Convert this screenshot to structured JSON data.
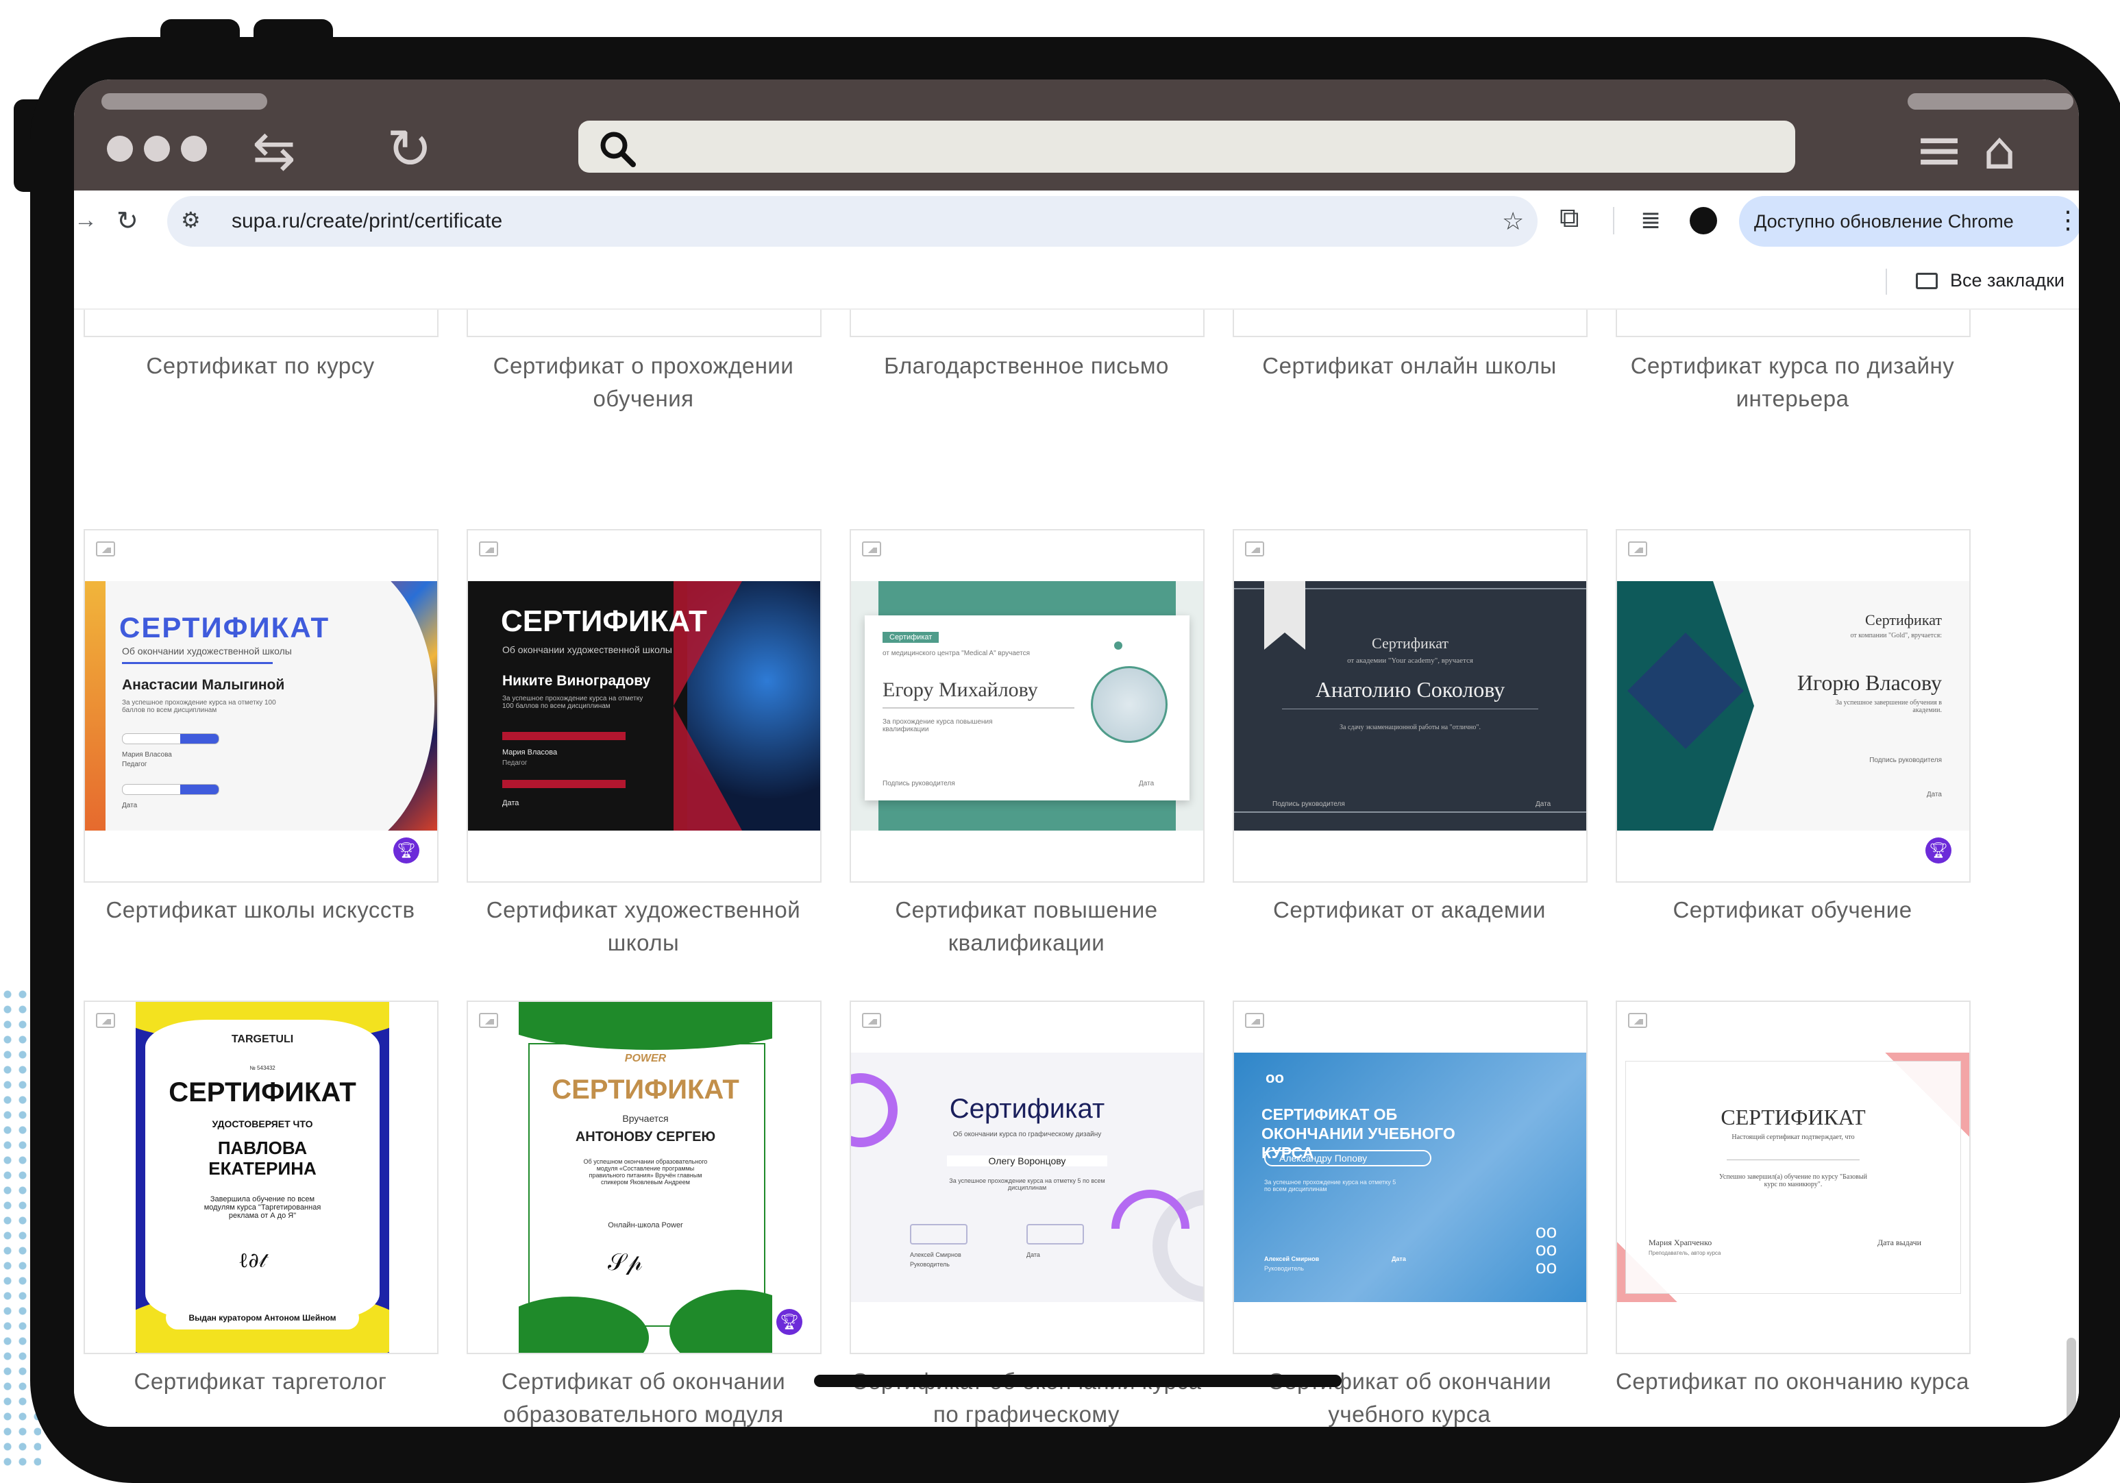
{
  "browser": {
    "url": "supa.ru/create/print/certificate",
    "update_label": "Доступно обновление Chrome",
    "bookmarks_label": "Все закладки"
  },
  "top_captions": [
    "Сертификат по курсу",
    "Сертификат о прохождении обучения",
    "Благодарственное письмо",
    "Сертификат онлайн школы",
    "Сертификат курса по дизайну интерьера"
  ],
  "rows": [
    {
      "cards": [
        {
          "caption": "Сертификат школы искусств",
          "premium": true,
          "thumb": {
            "title": "СЕРТИФИКАТ",
            "subtitle": "Об окончании художественной школы",
            "name": "Анастасии Малыгиной",
            "body": "За успешное прохождение курса на отметку 100 баллов по всем дисциплинам",
            "sign1": "Мария Власова",
            "sign1_role": "Педагог",
            "sign2": "Дата"
          }
        },
        {
          "caption": "Сертификат художественной школы",
          "premium": false,
          "thumb": {
            "title": "СЕРТИФИКАТ",
            "subtitle": "Об окончании художественной школы",
            "name": "Никите Виноградову",
            "body": "За успешное прохождение курса на отметку 100 баллов по всем дисциплинам",
            "sign1": "Мария Власова",
            "sign1_role": "Педагог",
            "sign2": "Дата"
          }
        },
        {
          "caption": "Сертификат повышение квалификации",
          "premium": false,
          "thumb": {
            "tag": "Сертификат",
            "subtitle": "от медицинского центра \"Medical A\" вручается",
            "name": "Егору Михайлову",
            "body": "За прохождение курса повышения квалификации",
            "sign1": "Подпись руководителя",
            "sign2": "Дата"
          }
        },
        {
          "caption": "Сертификат от академии",
          "premium": false,
          "thumb": {
            "title": "Сертификат",
            "subtitle": "от академии \"Your academy\", вручается",
            "name": "Анатолию Соколову",
            "body": "За сдачу экзаменационной работы на \"отлично\".",
            "sign1": "Подпись руководителя",
            "sign2": "Дата"
          }
        },
        {
          "caption": "Сертификат обучение",
          "premium": true,
          "thumb": {
            "title": "Сертификат",
            "subtitle": "от компании \"Gold\", вручается:",
            "name": "Игорю Власову",
            "body": "За успешное завершение обучения в академии.",
            "sign1": "Подпись руководителя",
            "sign2": "Дата"
          }
        }
      ]
    },
    {
      "cards": [
        {
          "caption": "Сертификат таргетолог",
          "premium": false,
          "thumb": {
            "brand": "TARGETULI",
            "number": "№ 543432",
            "title": "СЕРТИФИКАТ",
            "subtitle": "УДОСТОВЕРЯЕТ ЧТО",
            "name": "ПАВЛОВА ЕКАТЕРИНА",
            "body": "Завершила обучение по всем модулям курса \"Таргетированная реклама от А до Я\"",
            "footer": "Выдан куратором Антоном Шейном"
          }
        },
        {
          "caption": "Сертификат об окончании образовательного модуля",
          "premium": true,
          "thumb": {
            "brand": "POWER",
            "title": "СЕРТИФИКАТ",
            "subtitle": "Вручается",
            "name": "АНТОНОВУ СЕРГЕЮ",
            "body": "Об успешном окончании образовательного модуля «Составление программы правильного питания» Вручён главным спикером Яковлевым Андреем",
            "footer": "Онлайн-школа Power"
          }
        },
        {
          "caption": "Сертификат об окончании курса по графическому",
          "premium": false,
          "thumb": {
            "title": "Сертификат",
            "subtitle": "Об окончании курса по графическому дизайну",
            "name": "Олегу Воронцову",
            "body": "За успешное прохождение курса на отметку 5 по всем дисциплинам",
            "sign1": "Алексей Смирнов",
            "sign1_role": "Руководитель",
            "sign2": "Дата"
          }
        },
        {
          "caption": "Сертификат об окончании учебного курса",
          "premium": false,
          "thumb": {
            "title": "СЕРТИФИКАТ ОБ ОКОНЧАНИИ УЧЕБНОГО КУРСА",
            "name": "Александру Попову",
            "body": "За успешное прохождение курса на отметку 5 по всем дисциплинам",
            "sign1": "Алексей Смирнов",
            "sign1_role": "Руководитель",
            "sign2": "Дата"
          }
        },
        {
          "caption": "Сертификат по окончанию курса",
          "premium": false,
          "thumb": {
            "title": "СЕРТИФИКАТ",
            "subtitle": "Настоящий сертификат подтверждает, что",
            "body": "Успешно завершил(а) обучение по курсу \"Базовый курс по маникюру\".",
            "sign1": "Мария Храпченко",
            "sign1_role": "Преподаватель, автор курса",
            "sign2": "Дата выдачи"
          }
        }
      ]
    }
  ],
  "colors": {
    "chrome_top": "#4d4342",
    "address_bg": "#e9eef7",
    "update_bg": "#d3e3fd",
    "caption_text": "#5f5f5f",
    "premium_badge": "#6c2bd9"
  },
  "icons": [
    "search-icon",
    "back-icon",
    "reload-icon",
    "star-icon",
    "extensions-icon",
    "media-icon",
    "profile-icon",
    "menu-icon",
    "folder-icon",
    "home-icon",
    "image-icon",
    "trophy-icon"
  ]
}
